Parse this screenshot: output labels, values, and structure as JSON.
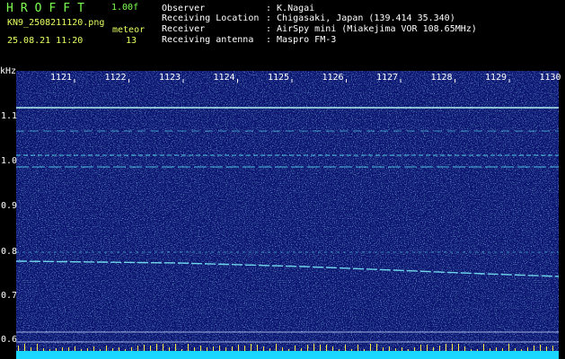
{
  "header": {
    "brand": "HROFFT",
    "version": "1.00f",
    "filename": "KN9_2508211120.png",
    "meteor_label": "meteor",
    "datetime": "25.08.21 11:20",
    "meteor_count": "13",
    "info": [
      {
        "label": "Observer",
        "value": ": K.Nagai"
      },
      {
        "label": "Receiving Location",
        "value": ": Chigasaki, Japan (139.414 35.340)"
      },
      {
        "label": "Receiver",
        "value": ": AirSpy mini (Miakejima VOR 108.65MHz)"
      },
      {
        "label": "Receiving antenna",
        "value": ": Maspro FM-3"
      }
    ]
  },
  "axis": {
    "unit": "kHz",
    "x_ticks": [
      "1121",
      "1122",
      "1123",
      "1124",
      "1125",
      "1126",
      "1127",
      "1128",
      "1129",
      "1130"
    ],
    "y_ticks": [
      "1.1",
      "1.0",
      "0.9",
      "0.8",
      "0.7",
      "0.6"
    ]
  },
  "colors": {
    "background": "#000000",
    "waterfall_bg": "#0a1470",
    "signal": "#5ff0ff",
    "header_green": "#7dff4f",
    "header_yellow": "#e8ff60",
    "base_band": "#19d7ff"
  }
}
